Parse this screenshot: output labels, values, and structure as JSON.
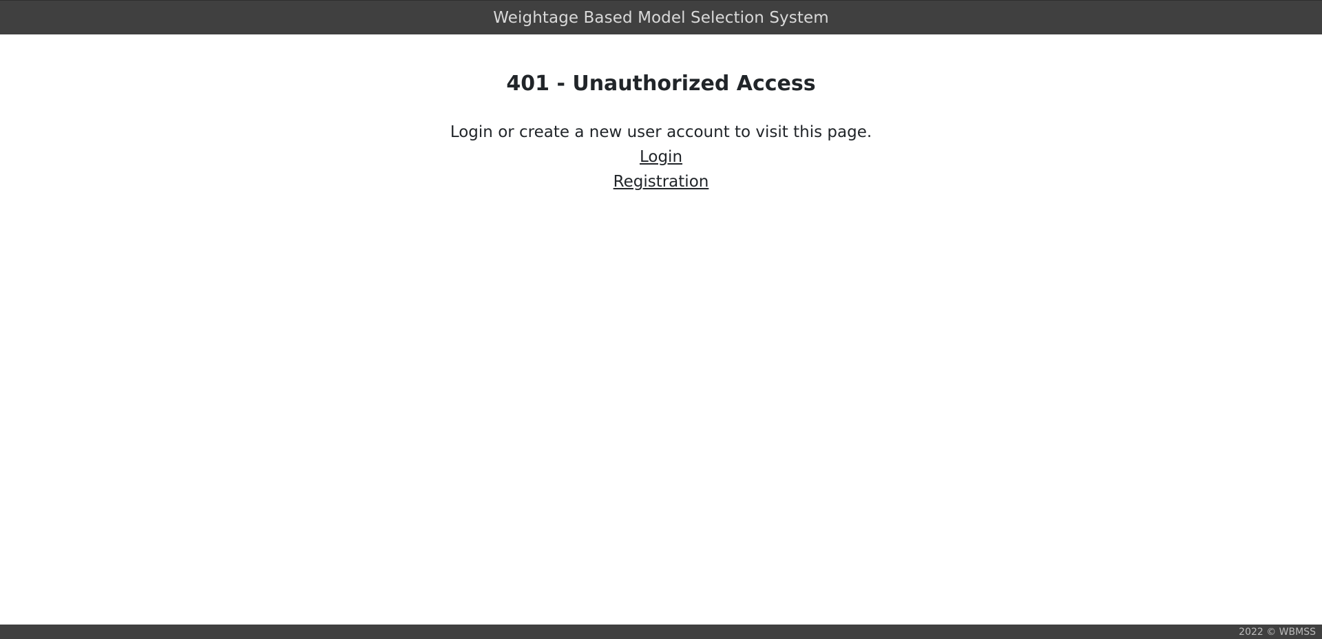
{
  "header": {
    "title": "Weightage Based Model Selection System"
  },
  "main": {
    "error_title": "401 - Unauthorized Access",
    "message": "Login or create a new user account to visit this page.",
    "links": {
      "login": "Login",
      "registration": "Registration"
    }
  },
  "footer": {
    "copyright": "2022 © WBMSS"
  },
  "colors": {
    "header_bg": "#404040",
    "footer_bg": "#404040",
    "text": "#212529",
    "background": "#ffffff"
  }
}
